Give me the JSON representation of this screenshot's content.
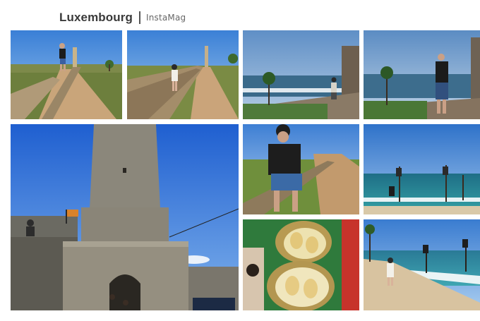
{
  "header": {
    "title": "Luxembourg",
    "brand": "InstaMag"
  }
}
